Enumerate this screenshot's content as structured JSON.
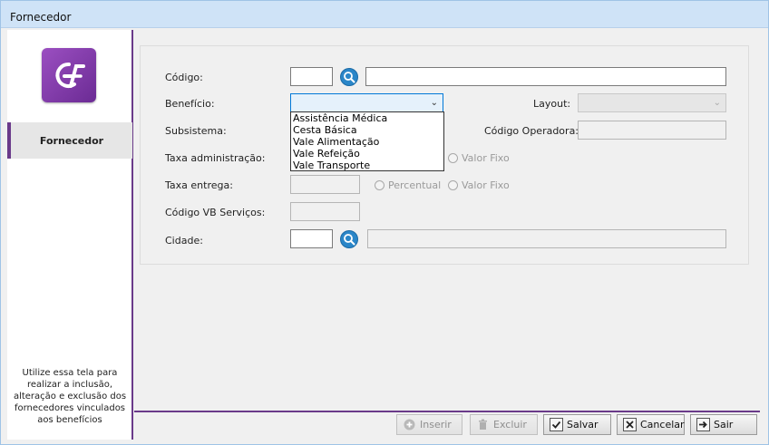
{
  "window": {
    "title": "Fornecedor"
  },
  "sidebar": {
    "logo_text": "GF",
    "nav_item": "Fornecedor",
    "help_text": "Utilize essa tela para realizar a inclusão, alteração e exclusão dos fornecedores vinculados aos benefícios"
  },
  "form": {
    "codigo_label": "Código:",
    "codigo_value": "",
    "descricao_value": "",
    "beneficio_label": "Benefício:",
    "beneficio_value": "",
    "layout_label": "Layout:",
    "layout_value": "",
    "subsistema_label": "Subsistema:",
    "codigo_operadora_label": "Código Operadora:",
    "codigo_operadora_value": "",
    "taxa_admin_label": "Taxa administração:",
    "taxa_entrega_label": "Taxa entrega:",
    "taxa_entrega_value": "",
    "percentual_label": "Percentual",
    "valor_fixo_label": "Valor Fixo",
    "codigo_vb_label": "Código VB Serviços:",
    "codigo_vb_value": "",
    "cidade_label": "Cidade:",
    "cidade_codigo_value": "",
    "cidade_nome_value": ""
  },
  "beneficio_options": [
    "Assistência Médica",
    "Cesta Básica",
    "Vale Alimentação",
    "Vale Refeição",
    "Vale Transporte"
  ],
  "toolbar": {
    "inserir": "Inserir",
    "excluir": "Excluir",
    "salvar": "Salvar",
    "cancelar": "Cancelar",
    "sair": "Sair"
  },
  "colors": {
    "accent": "#6a3a8a",
    "search_button": "#2a86c8",
    "titlebar": "#cfe3f7"
  },
  "icons": [
    "search-icon",
    "plus-circle-icon",
    "trash-icon",
    "check-icon",
    "cancel-icon",
    "exit-icon"
  ]
}
